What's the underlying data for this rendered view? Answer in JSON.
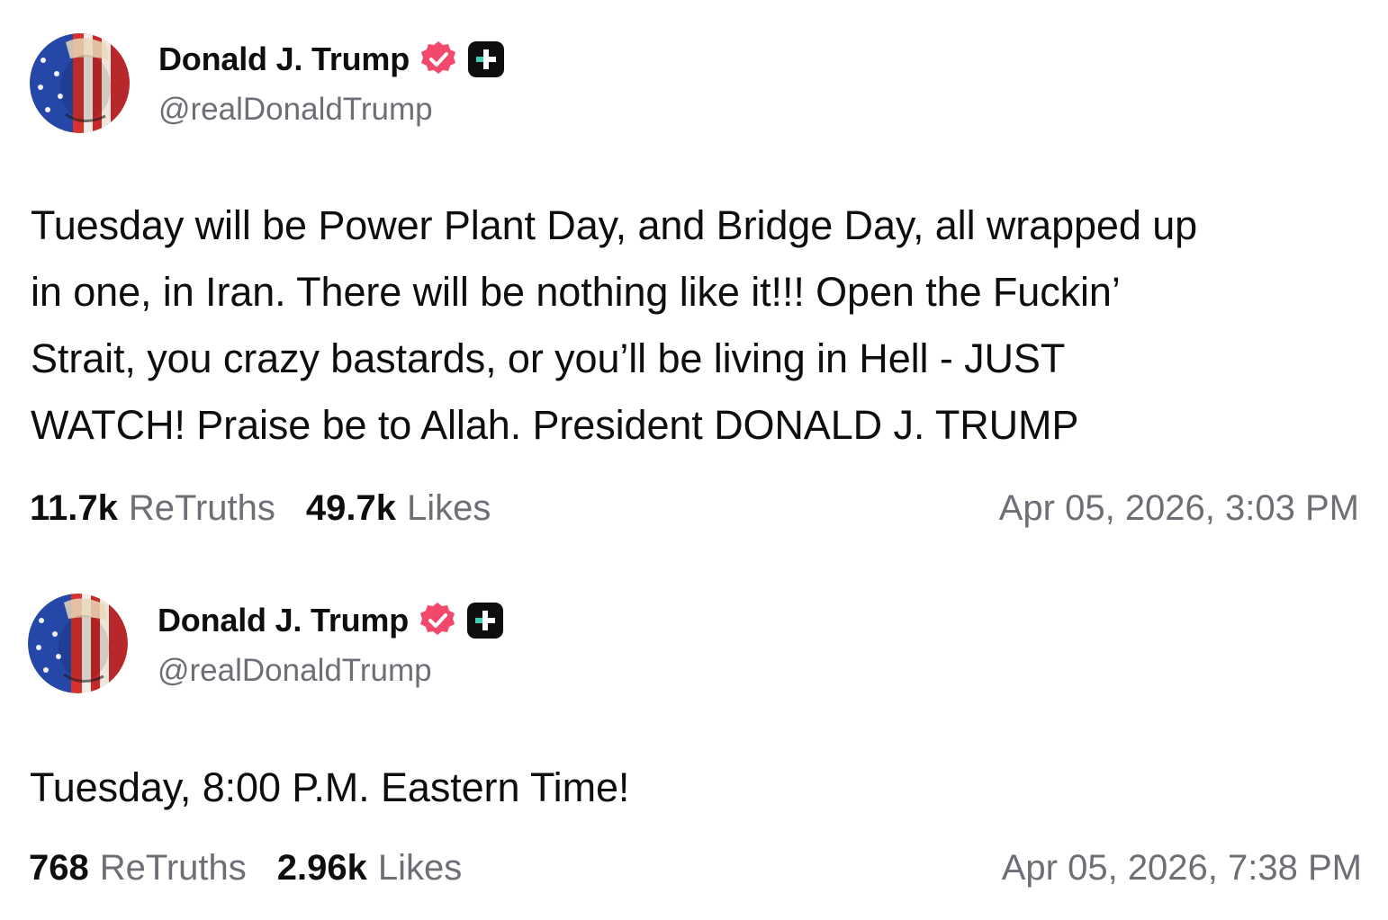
{
  "posts": [
    {
      "author": {
        "display_name": "Donald J. Trump",
        "handle": "@realDonaldTrump",
        "verified_icon": "verified-badge-icon",
        "plus_icon": "truth-plus-icon"
      },
      "text": "Tuesday will be Power Plant Day, and Bridge Day, all wrapped up\nin one, in Iran. There will be nothing like it!!! Open the Fuckin’\nStrait, you crazy bastards, or you’ll be living in Hell - JUST\nWATCH! Praise be to Allah. President DONALD J. TRUMP",
      "retruths_count": "11.7k",
      "retruths_label": "ReTruths",
      "likes_count": "49.7k",
      "likes_label": "Likes",
      "timestamp": "Apr 05, 2026, 3:03 PM"
    },
    {
      "author": {
        "display_name": "Donald J. Trump",
        "handle": "@realDonaldTrump",
        "verified_icon": "verified-badge-icon",
        "plus_icon": "truth-plus-icon"
      },
      "text": "Tuesday, 8:00 P.M. Eastern Time!",
      "retruths_count": "768",
      "retruths_label": "ReTruths",
      "likes_count": "2.96k",
      "likes_label": "Likes",
      "timestamp": "Apr 05, 2026, 7:38 PM"
    }
  ],
  "colors": {
    "text_primary": "#0e0e10",
    "text_secondary": "#6e6e76",
    "verified_badge": "#f2486c",
    "plus_badge": "#0e0e10"
  }
}
